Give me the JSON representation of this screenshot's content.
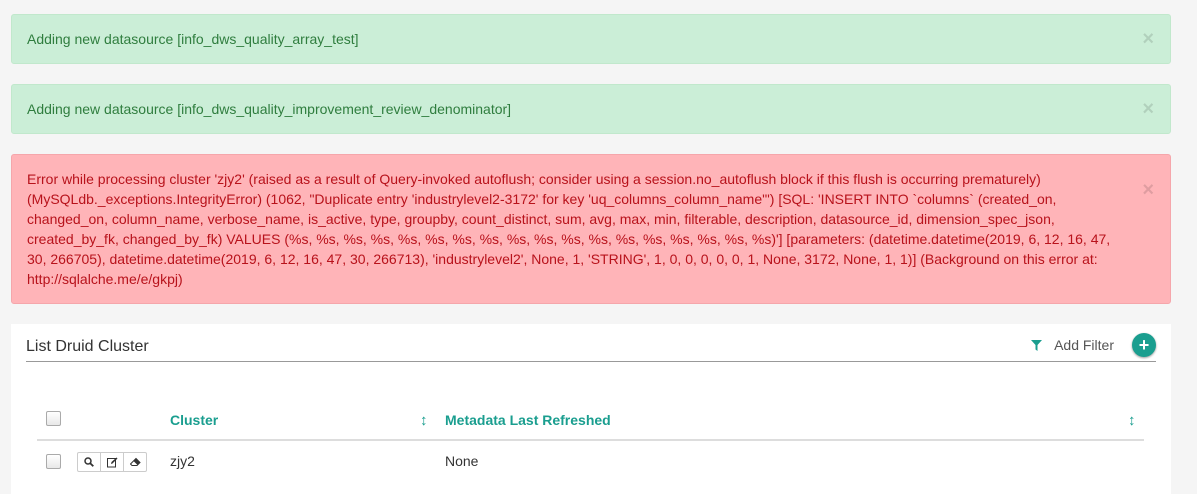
{
  "alerts": [
    {
      "type": "success",
      "message": "Adding new datasource [info_dws_quality_array_test]",
      "close": "×"
    },
    {
      "type": "success",
      "message": "Adding new datasource [info_dws_quality_improvement_review_denominator]",
      "close": "×"
    },
    {
      "type": "error",
      "message": "Error while processing cluster 'zjy2' (raised as a result of Query-invoked autoflush; consider using a session.no_autoflush block if this flush is occurring prematurely) (MySQLdb._exceptions.IntegrityError) (1062, \"Duplicate entry 'industrylevel2-3172' for key 'uq_columns_column_name'\") [SQL: 'INSERT INTO `columns` (created_on, changed_on, column_name, verbose_name, is_active, type, groupby, count_distinct, sum, avg, max, min, filterable, description, datasource_id, dimension_spec_json, created_by_fk, changed_by_fk) VALUES (%s, %s, %s, %s, %s, %s, %s, %s, %s, %s, %s, %s, %s, %s, %s, %s, %s, %s)'] [parameters: (datetime.datetime(2019, 6, 12, 16, 47, 30, 266705), datetime.datetime(2019, 6, 12, 16, 47, 30, 266713), 'industrylevel2', None, 1, 'STRING', 1, 0, 0, 0, 0, 0, 1, None, 3172, None, 1, 1)] (Background on this error at: http://sqlalche.me/e/gkpj)",
      "close": "×"
    }
  ],
  "panel": {
    "title": "List Druid Cluster",
    "add_filter_label": "Add Filter",
    "add_button_label": "+"
  },
  "table": {
    "columns": [
      "Cluster",
      "Metadata Last Refreshed"
    ],
    "sort_icon": "↕",
    "rows": [
      {
        "cluster": "zjy2",
        "metadata_last_refreshed": "None"
      }
    ]
  },
  "icons": {
    "filter": "filter-icon",
    "show": "search-icon",
    "edit": "edit-icon",
    "delete": "eraser-icon"
  },
  "colors": {
    "success_bg": "#cbeed7",
    "success_text": "#2f7d3e",
    "error_bg": "#ffb4b8",
    "error_text": "#b8121b",
    "accent": "#1a9e8f"
  }
}
